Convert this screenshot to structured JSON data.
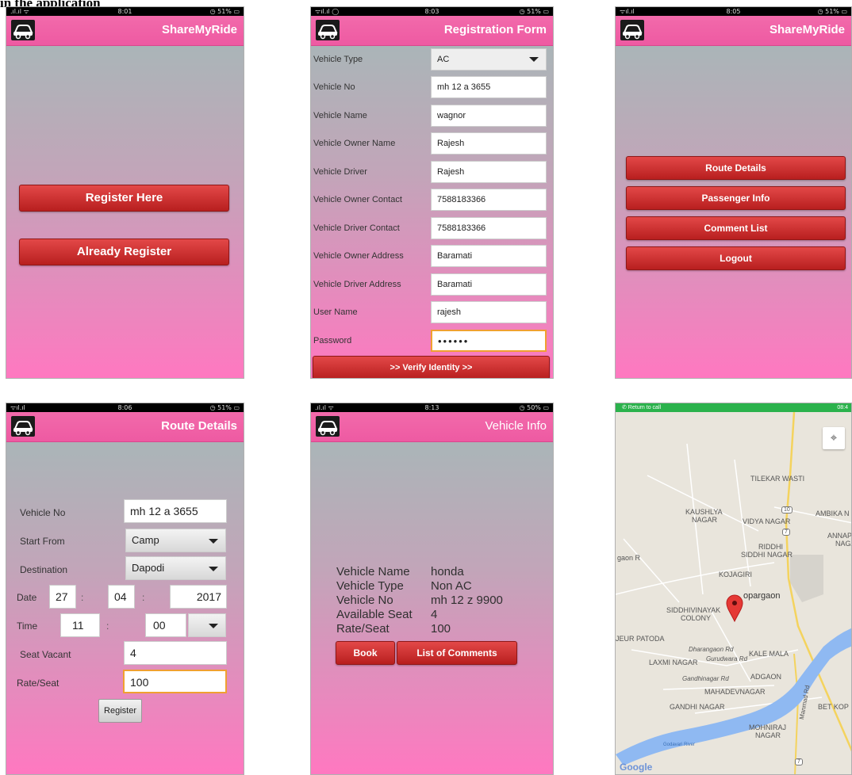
{
  "caption": "in the application",
  "screens": {
    "home": {
      "status": {
        "signal": ".ıl.ıl ᯤ",
        "time": "8:01",
        "battery": "◷ 51% ▭"
      },
      "title": "ShareMyRide",
      "register_here": "Register Here",
      "already_register": "Already Register"
    },
    "registration": {
      "status": {
        "signal": "ᯤıl.ıl ◯",
        "time": "8:03",
        "battery": "◷ 51% ▭"
      },
      "title": "Registration Form",
      "fields": [
        {
          "label": "Vehicle Type",
          "value": "AC"
        },
        {
          "label": "Vehicle No",
          "value": "mh 12 a 3655"
        },
        {
          "label": "Vehicle Name",
          "value": "wagnor"
        },
        {
          "label": "Vehicle Owner Name",
          "value": "Rajesh"
        },
        {
          "label": "Vehicle Driver",
          "value": "Rajesh"
        },
        {
          "label": "Vehicle Owner Contact",
          "value": "7588183366"
        },
        {
          "label": "Vehicle Driver Contact",
          "value": "7588183366"
        },
        {
          "label": "Vehicle Owner Address",
          "value": "Baramati"
        },
        {
          "label": "Vehicle Driver Address",
          "value": "Baramati"
        },
        {
          "label": "User Name",
          "value": "rajesh"
        },
        {
          "label": "Password",
          "value": "••••••"
        }
      ],
      "verify": ">> Verify Identity >>"
    },
    "menu": {
      "status": {
        "signal": "ᯤıl.ıl",
        "time": "8:05",
        "battery": "◷ 51% ▭"
      },
      "title": "ShareMyRide",
      "items": [
        "Route Details",
        "Passenger Info",
        "Comment List",
        "Logout"
      ]
    },
    "route": {
      "status": {
        "signal": "ᯤıl.ıl",
        "time": "8:06",
        "battery": "◷ 51% ▭"
      },
      "title": "Route Details",
      "vehicle_no_label": "Vehicle No",
      "vehicle_no": "mh 12 a 3655",
      "start_label": "Start From",
      "start": "Camp",
      "dest_label": "Destination",
      "dest": "Dapodi",
      "date_label": "Date",
      "day": "27",
      "month": "04",
      "year": "2017",
      "time_label": "Time",
      "hour": "11",
      "minute": "00",
      "seat_label": "Seat Vacant",
      "seat": "4",
      "rate_label": "Rate/Seat",
      "rate": "100",
      "register": "Register",
      "colon": ":"
    },
    "vehicle": {
      "status": {
        "signal": ".ıl.ıl ᯤ",
        "time": "8:13",
        "battery": "◷ 50% ▭"
      },
      "title": "Vehicle Info",
      "rows": [
        {
          "label": "Vehicle Name",
          "value": "honda"
        },
        {
          "label": "Vehicle Type",
          "value": "Non AC"
        },
        {
          "label": "Vehicle No",
          "value": "mh 12 z 9900"
        },
        {
          "label": "Available Seat",
          "value": "4"
        },
        {
          "label": "Rate/Seat",
          "value": "100"
        }
      ],
      "book": "Book",
      "comments": "List of Comments"
    },
    "map": {
      "return": "✆ Return to call",
      "time": "08:4",
      "labels": {
        "tilekar": "TILEKAR WASTI",
        "kaushlya": "KAUSHLYA",
        "nagar": "NAGAR",
        "vidya": "VIDYA NAGAR",
        "ambika": "AMBIKA N",
        "annapu": "ANNAPU",
        "naga": "NAGA",
        "riddhi": "RIDDHI",
        "siddhi": "SIDDHI NAGAR",
        "gaonr": "gaon R",
        "kojagiri": "KOJAGIRI",
        "kopargaon": "opargaon",
        "siddhivinayak": "SIDDHIVINAYAK",
        "colony": "COLONY",
        "jeur": "JEUR PATODA",
        "dharangaon": "Dharangaon Rd",
        "kalemala": "KALE MALA",
        "gurudwara": "Gurudwara Rd",
        "laxmi": "LAXMI NAGAR",
        "gandhinagar_rd": "Gandhinagar Rd",
        "adgaon": "ADGAON",
        "mahadev": "MAHADEVNAGAR",
        "gandhi": "GANDHI NAGAR",
        "betkop": "BET KOP",
        "mohniraj": "MOHNIRAJ",
        "nagar2": "NAGAR",
        "manmad": "Manmad Rd",
        "godavari": "Godavari River",
        "google": "Google",
        "s10": "10",
        "s7": "7",
        "s7b": "7",
        "s7c": "7"
      }
    }
  }
}
